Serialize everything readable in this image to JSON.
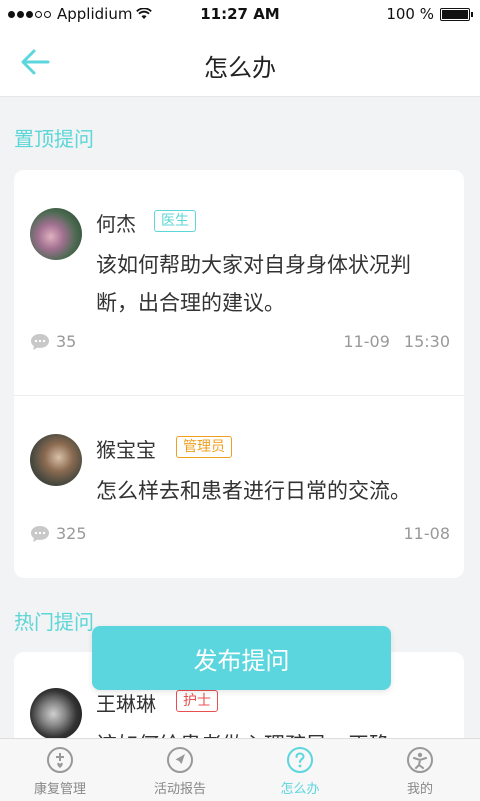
{
  "status": {
    "carrier": "Applidium",
    "time": "11:27 AM",
    "battery": "100 %"
  },
  "nav": {
    "title": "怎么办"
  },
  "sections": {
    "pinned": "置顶提问",
    "hot": "热门提问"
  },
  "pinned_posts": [
    {
      "author": "何杰",
      "badge": "医生",
      "question": "该如何帮助大家对自身身体状况判断，出合理的建议。",
      "comments": "35",
      "date": "11-09",
      "time": "15:30"
    },
    {
      "author": "猴宝宝",
      "badge": "管理员",
      "question": "怎么样去和患者进行日常的交流。",
      "comments": "325",
      "date": "11-08",
      "time": ""
    }
  ],
  "hot_posts": [
    {
      "author": "王琳琳",
      "badge": "护士",
      "question": "该如何给患者做心理疏导，正确"
    }
  ],
  "publish_button": "发布提问",
  "tabs": [
    {
      "label": "康复管理",
      "icon": "plus-heart-icon"
    },
    {
      "label": "活动报告",
      "icon": "compass-icon"
    },
    {
      "label": "怎么办",
      "icon": "question-icon"
    },
    {
      "label": "我的",
      "icon": "person-icon"
    }
  ],
  "colors": {
    "accent": "#5cd6de",
    "doctor": "#5cd6d6",
    "admin": "#f0a020",
    "nurse": "#e85050"
  }
}
